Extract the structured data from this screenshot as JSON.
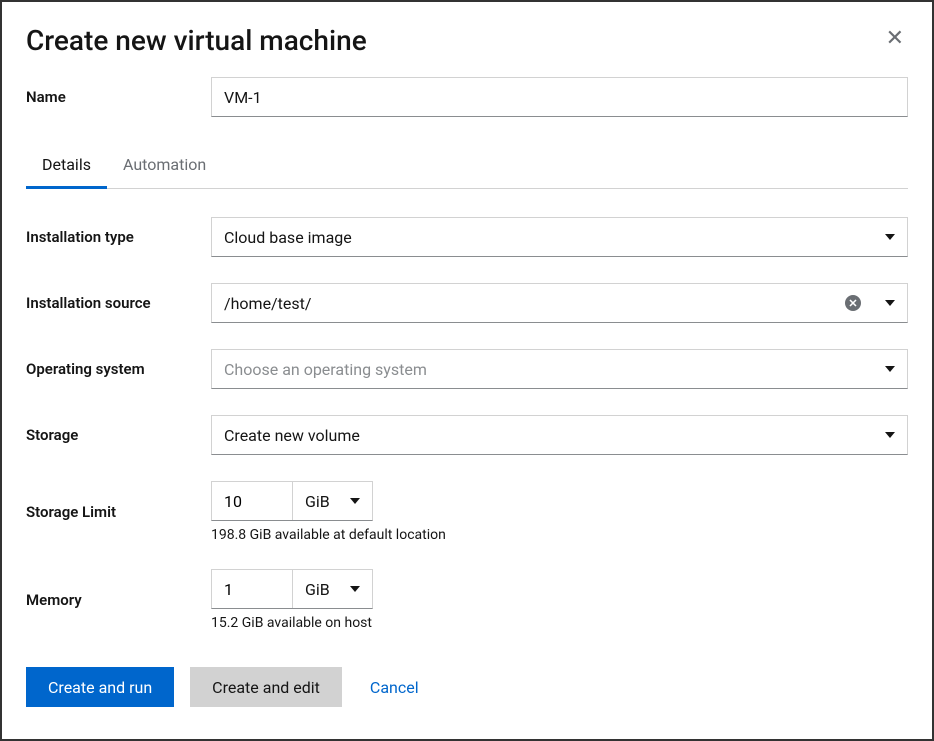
{
  "header": {
    "title": "Create new virtual machine"
  },
  "name": {
    "label": "Name",
    "value": "VM-1"
  },
  "tabs": {
    "details": "Details",
    "automation": "Automation"
  },
  "installation_type": {
    "label": "Installation type",
    "value": "Cloud base image"
  },
  "installation_source": {
    "label": "Installation source",
    "value": "/home/test/"
  },
  "operating_system": {
    "label": "Operating system",
    "placeholder": "Choose an operating system"
  },
  "storage": {
    "label": "Storage",
    "value": "Create new volume"
  },
  "storage_limit": {
    "label": "Storage Limit",
    "value": "10",
    "unit": "GiB",
    "help": "198.8 GiB available at default location"
  },
  "memory": {
    "label": "Memory",
    "value": "1",
    "unit": "GiB",
    "help": "15.2 GiB available on host"
  },
  "footer": {
    "create_run": "Create and run",
    "create_edit": "Create and edit",
    "cancel": "Cancel"
  }
}
